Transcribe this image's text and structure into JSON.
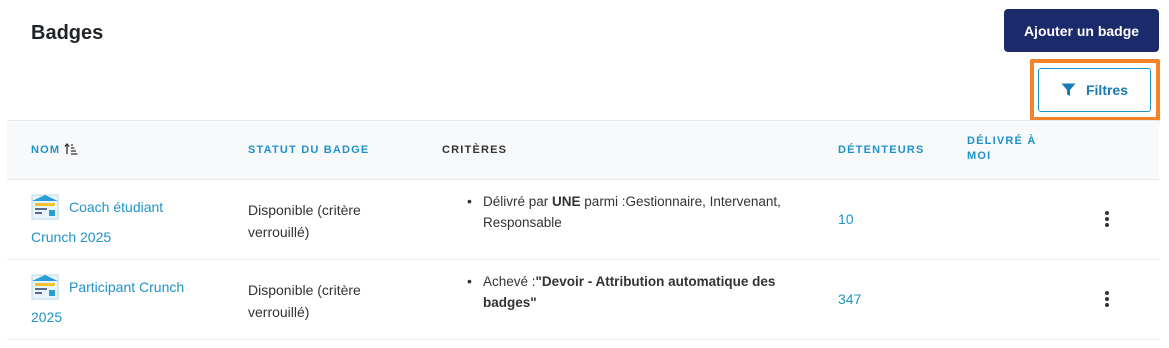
{
  "page": {
    "title": "Badges",
    "add_button_label": "Ajouter un badge",
    "filter_button_label": "Filtres"
  },
  "columns": {
    "name": "NOM",
    "status": "STATUT DU BADGE",
    "criteria": "CRITÈRES",
    "holders": "DÉTENTEURS",
    "delivered_line1": "DÉLIVRÉ À",
    "delivered_line2": "MOI"
  },
  "rows": [
    {
      "name": "Coach étudiant Crunch 2025",
      "status": "Disponible (critère verrouillé)",
      "criteria_prefix": "Délivré par ",
      "criteria_bold": "UNE",
      "criteria_suffix": " parmi :Gestionnaire, Intervenant, Responsable",
      "holders": "10"
    },
    {
      "name": "Participant Crunch 2025",
      "status": "Disponible (critère verrouillé)",
      "criteria_prefix": "Achevé :",
      "criteria_bold": "\"Devoir - Attribution automatique des badges\"",
      "criteria_suffix": "",
      "holders": "347"
    }
  ],
  "icons": {
    "filter": "filter-funnel-icon",
    "sort": "sort-ascending-icon",
    "row_menu": "more-vertical-icon",
    "badge": "badge-image-icon"
  },
  "colors": {
    "primary_button": "#1b2a6b",
    "link": "#1f93c9",
    "highlight": "#f5832a",
    "header_bg": "#f7f9fb"
  }
}
